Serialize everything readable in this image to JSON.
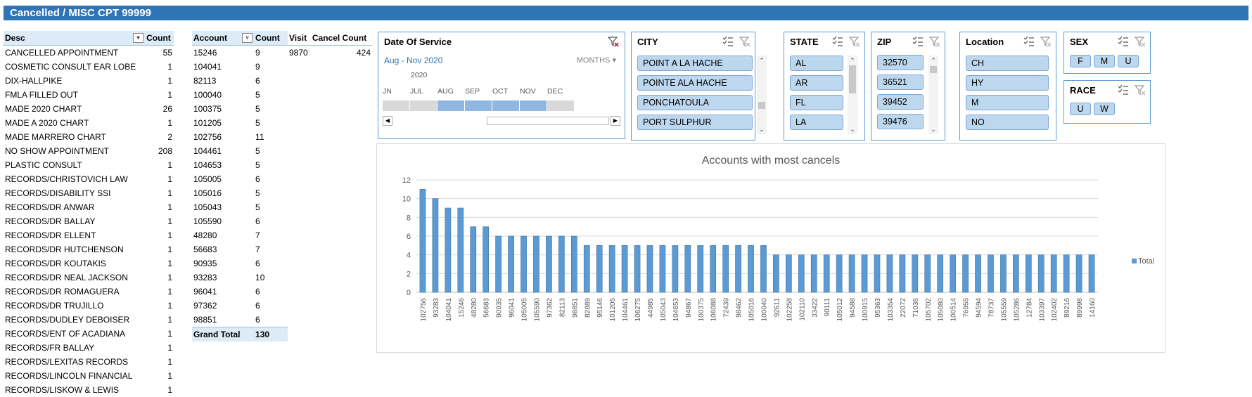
{
  "title": "Cancelled / MISC CPT 99999",
  "desc_table": {
    "headers": [
      "Desc",
      "Count"
    ],
    "rows": [
      [
        "CANCELLED APPOINTMENT",
        "55"
      ],
      [
        "COSMETIC CONSULT EAR LOBE",
        "1"
      ],
      [
        "DIX-HALLPIKE",
        "1"
      ],
      [
        "FMLA FILLED OUT",
        "1"
      ],
      [
        "MADE 2020 CHART",
        "26"
      ],
      [
        "MADE A 2020 CHART",
        "1"
      ],
      [
        "MADE MARRERO CHART",
        "2"
      ],
      [
        "NO SHOW APPOINTMENT",
        "208"
      ],
      [
        "PLASTIC CONSULT",
        "1"
      ],
      [
        "RECORDS/CHRISTOVICH LAW",
        "1"
      ],
      [
        "RECORDS/DISABILITY SSI",
        "1"
      ],
      [
        "RECORDS/DR ANWAR",
        "1"
      ],
      [
        "RECORDS/DR BALLAY",
        "1"
      ],
      [
        "RECORDS/DR ELLENT",
        "1"
      ],
      [
        "RECORDS/DR HUTCHENSON",
        "1"
      ],
      [
        "RECORDS/DR KOUTAKIS",
        "1"
      ],
      [
        "RECORDS/DR NEAL JACKSON",
        "1"
      ],
      [
        "RECORDS/DR ROMAGUERA",
        "1"
      ],
      [
        "RECORDS/DR TRUJILLO",
        "1"
      ],
      [
        "RECORDS/DUDLEY DEBOISER",
        "1"
      ],
      [
        "RECORDS/ENT OF ACADIANA",
        "1"
      ],
      [
        "RECORDS/FR BALLAY",
        "1"
      ],
      [
        "RECORDS/LEXITAS RECORDS",
        "1"
      ],
      [
        "RECORDS/LINCOLN FINANCIAL",
        "1"
      ],
      [
        "RECORDS/LISKOW & LEWIS",
        "1"
      ]
    ]
  },
  "account_table": {
    "headers": [
      "Account",
      "Count"
    ],
    "rows": [
      [
        "15246",
        "9"
      ],
      [
        "104041",
        "9"
      ],
      [
        "82113",
        "6"
      ],
      [
        "100040",
        "5"
      ],
      [
        "100375",
        "5"
      ],
      [
        "101205",
        "5"
      ],
      [
        "102756",
        "11"
      ],
      [
        "104461",
        "5"
      ],
      [
        "104653",
        "5"
      ],
      [
        "105005",
        "6"
      ],
      [
        "105016",
        "5"
      ],
      [
        "105043",
        "5"
      ],
      [
        "105590",
        "6"
      ],
      [
        "48280",
        "7"
      ],
      [
        "56683",
        "7"
      ],
      [
        "90935",
        "6"
      ],
      [
        "93283",
        "10"
      ],
      [
        "96041",
        "6"
      ],
      [
        "97362",
        "6"
      ],
      [
        "98851",
        "6"
      ]
    ],
    "total_label": "Grand Total",
    "total_value": "130"
  },
  "visit_table": {
    "headers": [
      "Visit",
      "Cancel Count"
    ],
    "rows": [
      [
        "9870",
        "424"
      ]
    ]
  },
  "timeline": {
    "title": "Date Of Service",
    "range_label": "Aug - Nov 2020",
    "level_label": "MONTHS",
    "year_label": "2020",
    "months": [
      "JN",
      "JUL",
      "AUG",
      "SEP",
      "OCT",
      "NOV",
      "DEC"
    ],
    "selected_months": [
      "AUG",
      "SEP",
      "OCT",
      "NOV"
    ]
  },
  "slicers": {
    "city": {
      "title": "CITY",
      "items": [
        "POINT A LA HACHE",
        "POINTE ALA HACHE",
        "PONCHATOULA",
        "PORT SULPHUR"
      ]
    },
    "state": {
      "title": "STATE",
      "items": [
        "AL",
        "AR",
        "FL",
        "LA"
      ]
    },
    "zip": {
      "title": "ZIP",
      "items": [
        "32570",
        "36521",
        "39452",
        "39476"
      ]
    },
    "location": {
      "title": "Location",
      "items": [
        "CH",
        "HY",
        "M",
        "NO"
      ]
    },
    "sex": {
      "title": "SEX",
      "items": [
        "F",
        "M",
        "U"
      ]
    },
    "race": {
      "title": "RACE",
      "items": [
        "U",
        "W"
      ]
    }
  },
  "colors": {
    "accent": "#2e75b6",
    "bar": "#5b9bd5",
    "slicer_item": "#bdd7ee",
    "header_fill": "#ddebf7"
  },
  "chart_data": {
    "type": "bar",
    "title": "Accounts with most cancels",
    "ylim": [
      0,
      12
    ],
    "yticks": [
      0,
      2,
      4,
      6,
      8,
      10,
      12
    ],
    "grid": true,
    "legend_position": "right",
    "categories": [
      "102756",
      "93283",
      "104041",
      "15246",
      "48280",
      "56683",
      "90935",
      "96041",
      "105005",
      "105590",
      "97362",
      "82113",
      "98851",
      "82889",
      "95146",
      "101205",
      "104461",
      "106275",
      "44985",
      "105043",
      "104653",
      "94867",
      "100375",
      "106088",
      "72439",
      "98462",
      "105016",
      "100040",
      "92611",
      "102258",
      "102110",
      "33422",
      "90111",
      "105012",
      "94588",
      "100915",
      "95363",
      "103354",
      "22072",
      "71036",
      "105702",
      "105080",
      "100514",
      "76955",
      "94594",
      "78737",
      "105559",
      "105286",
      "12784",
      "103397",
      "102402",
      "89216",
      "89998",
      "14160"
    ],
    "series": [
      {
        "name": "Total",
        "values": [
          11,
          10,
          9,
          9,
          7,
          7,
          6,
          6,
          6,
          6,
          6,
          6,
          6,
          5,
          5,
          5,
          5,
          5,
          5,
          5,
          5,
          5,
          5,
          5,
          5,
          5,
          5,
          5,
          4,
          4,
          4,
          4,
          4,
          4,
          4,
          4,
          4,
          4,
          4,
          4,
          4,
          4,
          4,
          4,
          4,
          4,
          4,
          4,
          4,
          4,
          4,
          4,
          4,
          4
        ]
      }
    ]
  }
}
